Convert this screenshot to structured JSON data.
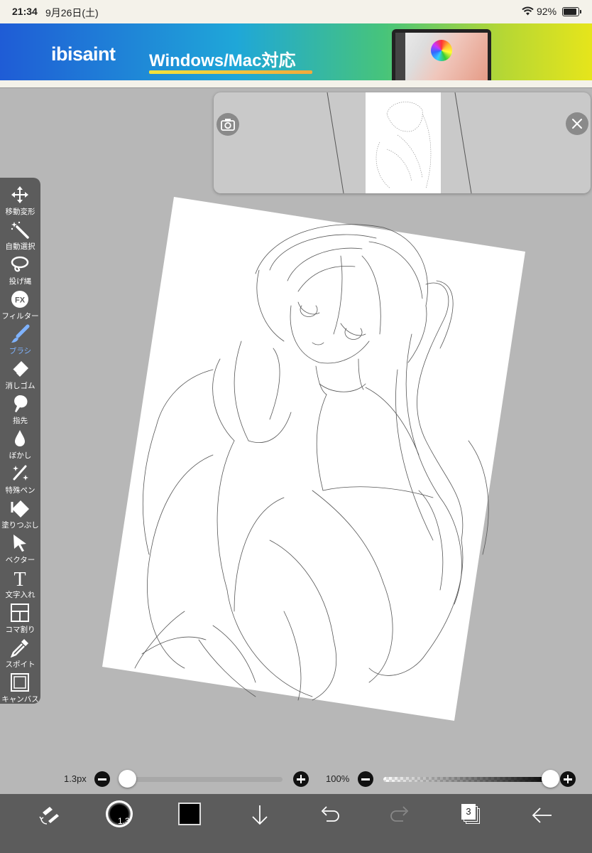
{
  "status_bar": {
    "time": "21:34",
    "date": "9月26日(土)",
    "battery": "92%"
  },
  "ad": {
    "logo_left": "ibis",
    "logo_right": "aint",
    "text": "Windows/Mac対応"
  },
  "tools": [
    {
      "id": "move",
      "label": "移動変形",
      "icon": "move-arrows-icon"
    },
    {
      "id": "magic-wand",
      "label": "自動選択",
      "icon": "magic-wand-icon"
    },
    {
      "id": "lasso",
      "label": "投げ縄",
      "icon": "lasso-icon"
    },
    {
      "id": "filter",
      "label": "フィルター",
      "icon": "fx-icon"
    },
    {
      "id": "brush",
      "label": "ブラシ",
      "icon": "brush-icon",
      "active": true
    },
    {
      "id": "eraser",
      "label": "消しゴム",
      "icon": "eraser-icon"
    },
    {
      "id": "smudge",
      "label": "指先",
      "icon": "finger-icon"
    },
    {
      "id": "blur",
      "label": "ぼかし",
      "icon": "drop-icon"
    },
    {
      "id": "special-pen",
      "label": "特殊ペン",
      "icon": "sparkle-pen-icon"
    },
    {
      "id": "fill",
      "label": "塗りつぶし",
      "icon": "bucket-icon"
    },
    {
      "id": "vector",
      "label": "ベクター",
      "icon": "cursor-icon"
    },
    {
      "id": "text",
      "label": "文字入れ",
      "icon": "text-icon"
    },
    {
      "id": "frame",
      "label": "コマ割り",
      "icon": "frame-icon"
    },
    {
      "id": "eyedropper",
      "label": "スポイト",
      "icon": "eyedropper-icon"
    },
    {
      "id": "canvas",
      "label": "キャンバス",
      "icon": "canvas-icon"
    }
  ],
  "sliders": {
    "brush_size_label": "1.3px",
    "brush_size_fraction": 0.0,
    "opacity_label": "100%",
    "opacity_fraction": 1.0
  },
  "bottom_bar": {
    "brush_size_badge": "1.3",
    "layer_count": "3",
    "current_color": "#000000"
  },
  "colors": {
    "active_tool": "#7fb3ff",
    "toolbar_bg": "#5c5c5c",
    "canvas_bg": "#b7b7b7"
  }
}
